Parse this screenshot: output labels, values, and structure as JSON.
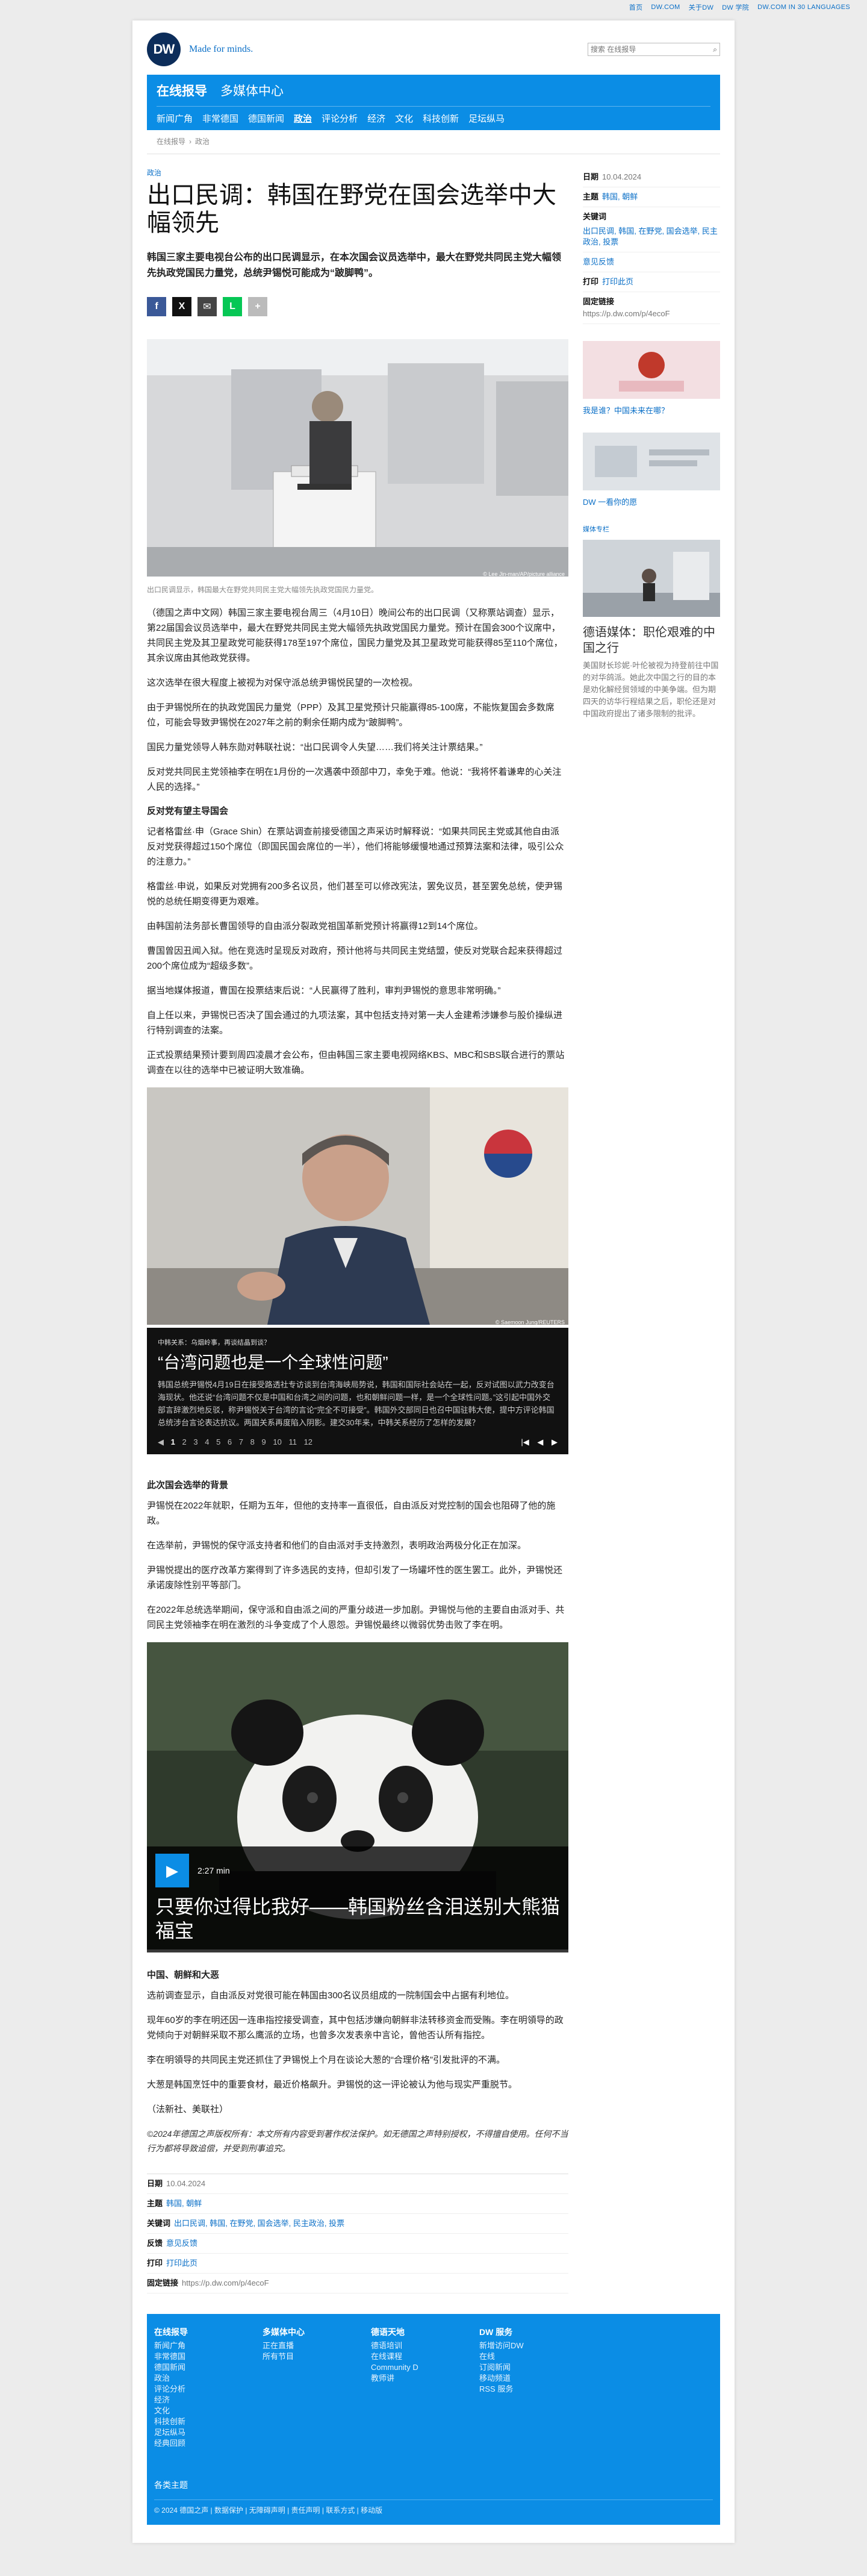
{
  "topbar": [
    "首页",
    "DW.COM",
    "关于DW",
    "DW 学院",
    "DW.COM IN 30 LANGUAGES"
  ],
  "brand": {
    "logo": "DW",
    "slogan": "Made for minds."
  },
  "search": {
    "placeholder": "搜索 在线报导"
  },
  "nav": {
    "primary": "在线报导",
    "secondary": "多媒体中心",
    "items": [
      "新闻广角",
      "非常德国",
      "德国新闻",
      "政治",
      "评论分析",
      "经济",
      "文化",
      "科技创新",
      "足坛纵马"
    ]
  },
  "breadcrumb": [
    "在线报导",
    "政治"
  ],
  "article": {
    "kicker": "政治",
    "title": "出口民调：韩国在野党在国会选举中大幅领先",
    "lead": "韩国三家主要电视台公布的出口民调显示，在本次国会议员选举中，最大在野党共同民主党大幅领先执政党国民力量党，总统尹锡悦可能成为“跛脚鸭”。",
    "share": [
      "f",
      "X",
      "✉",
      "L",
      "+"
    ],
    "hero_credit": "© Lee Jin-man/AP/picture alliance",
    "hero_caption": "出口民调显示，韩国最大在野党共同民主党大幅领先执政党国民力量党。",
    "paragraphs1": [
      "（德国之声中文网）韩国三家主要电视台周三（4月10日）晚间公布的出口民调（又称票站调查）显示，第22届国会议员选举中，最大在野党共同民主党大幅领先执政党国民力量党。预计在国会300个议席中，共同民主党及其卫星政党可能获得178至197个席位，国民力量党及其卫星政党可能获得85至110个席位，其余议席由其他政党获得。",
      "这次选举在很大程度上被视为对保守派总统尹锡悦民望的一次检视。",
      "由于尹锡悦所在的执政党国民力量党（PPP）及其卫星党预计只能赢得85-100席，不能恢复国会多数席位，可能会导致尹锡悦在2027年之前的剩余任期内成为“跛脚鸭”。",
      "国民力量党领导人韩东勋对韩联社说：“出口民调令人失望……我们将关注计票结果。”",
      "反对党共同民主党领袖李在明在1月份的一次遇袭中颈部中刀，幸免于难。他说：“我将怀着谦卑的心关注人民的选择。”"
    ],
    "h_opp": "反对党有望主导国会",
    "paragraphs2": [
      "记者格雷丝·申（Grace Shin）在票站调查前接受德国之声采访时解释说：“如果共同民主党或其他自由派反对党获得超过150个席位（即国民国会席位的一半），他们将能够缓慢地通过预算法案和法律，吸引公众的注意力。”",
      "格雷丝·申说，如果反对党拥有200多名议员，他们甚至可以修改宪法，罢免议员，甚至罢免总统，使尹锡悦的总统任期变得更为艰难。",
      "由韩国前法务部长曹国领导的自由派分裂政党祖国革新党预计将赢得12到14个席位。",
      "曹国曾因丑闻入狱。他在竞选时呈现反对政府，预计他将与共同民主党结盟，使反对党联合起来获得超过200个席位成为“超级多数”。",
      "据当地媒体报道，曹国在投票结束后说：“人民赢得了胜利，审判尹锡悦的意思非常明确。”",
      "自上任以来，尹锡悦已否决了国会通过的九项法案，其中包括支持对第一夫人金建希涉嫌参与股价操纵进行特别调查的法案。",
      "正式投票结果预计要到周四凌晨才会公布，但由韩国三家主要电视网络KBS、MBC和SBS联合进行的票站调查在以往的选举中已被证明大致准确。"
    ],
    "gallery": {
      "credit": "© Saemoon Jung/REUTERS",
      "kicker": "中韩关系：乌烟岭事，再谈结晶到谈？",
      "title": "“台湾问题也是一个全球性问题”",
      "desc": "韩国总统尹锡悦4月19日在接受路透社专访谈到台湾海峡局势说，韩国和国际社会站在一起，反对试图以武力改变台海现状。他还说“台湾问题不仅是中国和台湾之间的问题，也和朝鲜问题一样，是一个全球性问题。”这引起中国外交部言辞激烈地反驳，称尹锡悦关于台湾的言论“完全不可接受”。韩国外交部同日也召中国驻韩大使，提中方评论韩国总统涉台言论表达抗议。两国关系再度陷入阴影。建交30年来，中韩关系经历了怎样的发展？",
      "pages": [
        "1",
        "2",
        "3",
        "4",
        "5",
        "6",
        "7",
        "8",
        "9",
        "10",
        "11",
        "12"
      ],
      "ctrls": [
        "|◀",
        "◀",
        "▶"
      ]
    },
    "h_bg": "此次国会选举的背景",
    "paragraphs3": [
      "尹锡悦在2022年就职，任期为五年，但他的支持率一直很低，自由派反对党控制的国会也阻碍了他的施政。",
      "在选举前，尹锡悦的保守派支持者和他们的自由派对手支持激烈，表明政治两极分化正在加深。",
      "尹锡悦提出的医疗改革方案得到了许多选民的支持，但却引发了一场罐坏性的医生罢工。此外，尹锡悦还承诺废除性别平等部门。",
      "在2022年总统选举期间，保守派和自由派之间的严重分歧进一步加剧。尹锡悦与他的主要自由派对手、共同民主党领袖李在明在激烈的斗争变成了个人恩怨。尹锡悦最终以微弱优势击败了李在明。"
    ],
    "video": {
      "duration": "2:27 min",
      "title": "只要你过得比我好——韩国粉丝含泪送别大熊猫福宝"
    },
    "h_cn": "中国、朝鲜和大恶",
    "paragraphs4": [
      "选前调查显示，自由派反对党很可能在韩国由300名议员组成的一院制国会中占据有利地位。",
      "现年60岁的李在明还因一连串指控接受调查，其中包括涉嫌向朝鲜非法转移资金而受贿。李在明領导的政党倾向于对朝鲜采取不那么鹰派的立场，也曾多次发表亲中言论，曾他否认所有指控。",
      "李在明領导的共同民主党还抓住了尹锡悦上个月在谈论大葱的“合理价格”引发批评的不满。",
      "大葱是韩国烹饪中的重要食材，最近价格飙升。尹锡悦的这一评论被认为他与现实严重脱节。",
      "（法新社、美联社）"
    ],
    "copyright": "©2024年德国之声版权所有：本文所有内容受到著作权法保护。如无德国之声特别授权，不得擅自使用。任何不当行为都将导致追偿，并受到刑事追究。"
  },
  "meta": {
    "date_label": "日期",
    "date": "10.04.2024",
    "topic_label": "主题",
    "topics": "韩国, 朝鲜",
    "keywords_label": "关键词",
    "keywords": "出口民调, 韩国, 在野党, 国会选举, 民主政治, 投票",
    "keywords_side": "出口民调, 韩国, 在野党, 国会选举, 民主政治, 投票",
    "feedback_label": "反馈",
    "feedback": "意见反馈",
    "print_label": "打印",
    "print": "打印此页",
    "permalink_label": "固定链接",
    "permalink": "https://p.dw.com/p/4ecoF"
  },
  "sidebar": {
    "tile1": "我是谁？中国未来在哪？",
    "tile2": "DW 一看你的愿",
    "section": "媒体专栏",
    "article_title": "德语媒体：职伦艰难的中国之行",
    "article_desc": "美国财长珍妮·叶伦被视为持登前往中国的对华鸽派。她此次中国之行的目的本是劝化解经贸领域的中美争端。但为期四天的访华行程结果之后，职伦还是对中国政府提出了诸多限制的批评。"
  },
  "footer": {
    "cols": [
      {
        "h": "在线报导",
        "items": [
          "新闻广角",
          "非常德国",
          "德国新闻",
          "政治",
          "评论分析",
          "经济",
          "文化",
          "科技创新",
          "足坛纵马",
          "经典回顾"
        ]
      },
      {
        "h": "多媒体中心",
        "items": [
          "正在直播",
          "所有节目"
        ]
      },
      {
        "h": "德语天地",
        "items": [
          "德语培训",
          "在线课程",
          "Community D",
          "教师讲"
        ]
      },
      {
        "h": "DW 服务",
        "items": [
          "新增访问DW",
          "在线",
          "订阅新闻",
          "移动频道",
          "RSS 服务"
        ]
      }
    ],
    "bottom_link": "各类主题",
    "legal": "© 2024 德国之声 | 数据保护 | 无障碍声明 | 责任声明 | 联系方式 | 移动版"
  },
  "colors": {
    "brand_blue": "#0b8de5",
    "navy": "#0c2d5a",
    "link": "#0a6fc7"
  }
}
